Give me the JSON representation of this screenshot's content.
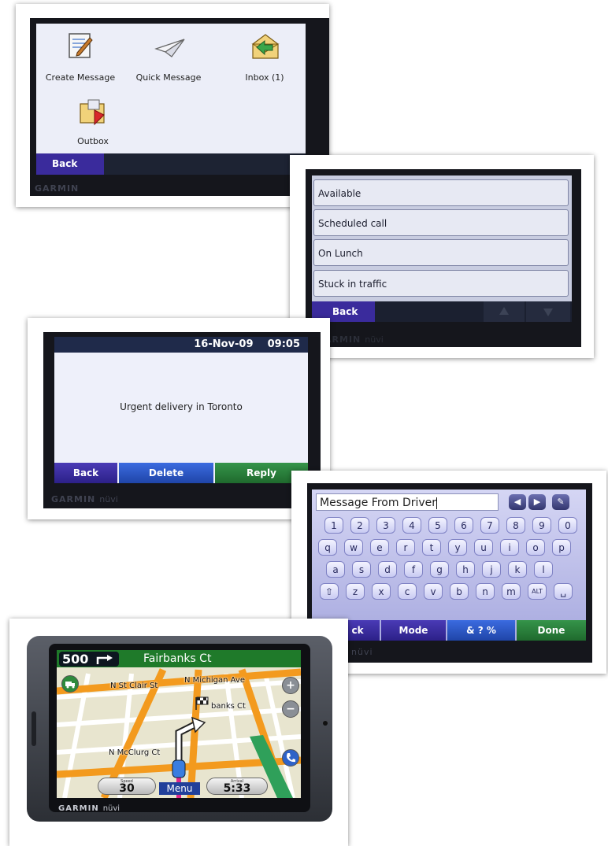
{
  "screen_messages": {
    "items": [
      {
        "label": "Create Message",
        "icon": "create-message-icon"
      },
      {
        "label": "Quick Message",
        "icon": "quick-message-icon"
      },
      {
        "label": "Inbox (1)",
        "icon": "inbox-icon"
      },
      {
        "label": "Outbox",
        "icon": "outbox-icon"
      }
    ],
    "back_label": "Back",
    "brand": "GARMIN"
  },
  "screen_quick": {
    "items": [
      "Available",
      "Scheduled call",
      "On Lunch",
      "Stuck in traffic"
    ],
    "back_label": "Back",
    "brand": "GARMIN",
    "model": "nüvi"
  },
  "screen_inbox": {
    "date": "16-Nov-09",
    "time": "09:05",
    "message": "Urgent delivery in Toronto",
    "back_label": "Back",
    "delete_label": "Delete",
    "reply_label": "Reply",
    "brand": "GARMIN",
    "model": "nüvi"
  },
  "screen_keyboard": {
    "field_value": "Message From Driver",
    "row_numbers": [
      "1",
      "2",
      "3",
      "4",
      "5",
      "6",
      "7",
      "8",
      "9",
      "0"
    ],
    "row_top": [
      "q",
      "w",
      "e",
      "r",
      "t",
      "y",
      "u",
      "i",
      "o",
      "p"
    ],
    "row_mid": [
      "a",
      "s",
      "d",
      "f",
      "g",
      "h",
      "j",
      "k",
      "l"
    ],
    "row_bot": [
      "⇧",
      "z",
      "x",
      "c",
      "v",
      "b",
      "n",
      "m",
      "ALT",
      "␣"
    ],
    "back_label": "ck",
    "mode_label": "Mode",
    "symbols_label": "& ? %",
    "done_label": "Done",
    "model": "nüvi"
  },
  "screen_map": {
    "distance": "500",
    "street": "Fairbanks Ct",
    "labels": {
      "michigan": "N Michigan Ave",
      "stclair": "N St Clair St",
      "fairbanks": "banks Ct",
      "mcclurg": "N McClurg Ct"
    },
    "speed_caption": "Speed",
    "speed": "30",
    "menu_label": "Menu",
    "arrival_caption": "Arrival",
    "arrival": "5:33",
    "brand": "GARMIN",
    "model": "nüvi"
  },
  "colors": {
    "purple_button": "#3a2b9c",
    "blue_button": "#2a55c8",
    "green_button": "#2a7f37",
    "street_bar": "#1f7a2a",
    "road_orange": "#f39a1e"
  }
}
